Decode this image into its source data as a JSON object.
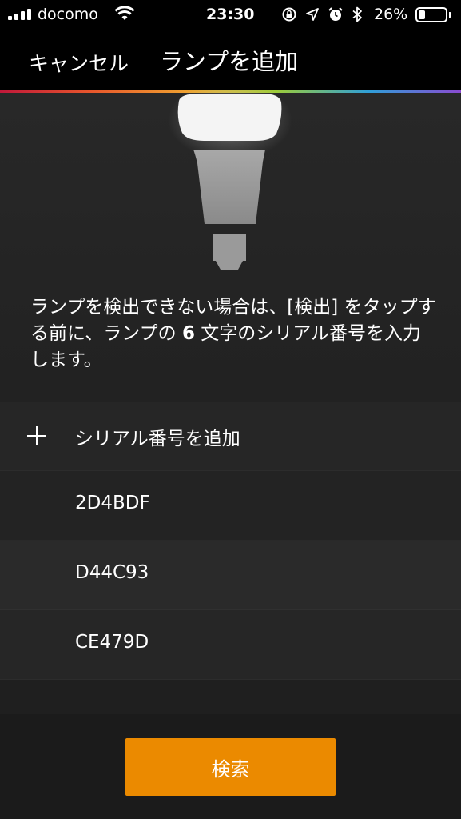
{
  "status_bar": {
    "carrier": "docomo",
    "time": "23:30",
    "battery_percent": "26%",
    "battery_level": 0.26,
    "signal_bars": 4,
    "icons": [
      "wifi-icon",
      "screen-rotation-lock-icon",
      "location-arrow-icon",
      "alarm-icon",
      "bluetooth-icon",
      "battery-icon"
    ]
  },
  "nav": {
    "cancel_label": "キャンセル",
    "title": "ランプを追加"
  },
  "hero": {
    "icon": "lamp-bulb-icon"
  },
  "message": {
    "before": "ランプを検出できない場合は、[検出] をタップする前に、ランプの ",
    "count": "6",
    "after": " 文字のシリアル番号を入力します。"
  },
  "serial_list": {
    "add_label": "シリアル番号を追加",
    "items": [
      "2D4BDF",
      "D44C93",
      "CE479D"
    ]
  },
  "search_button_label": "検索",
  "colors": {
    "accent": "#eb8a00",
    "background": "#232323",
    "nav_background": "#000000"
  }
}
